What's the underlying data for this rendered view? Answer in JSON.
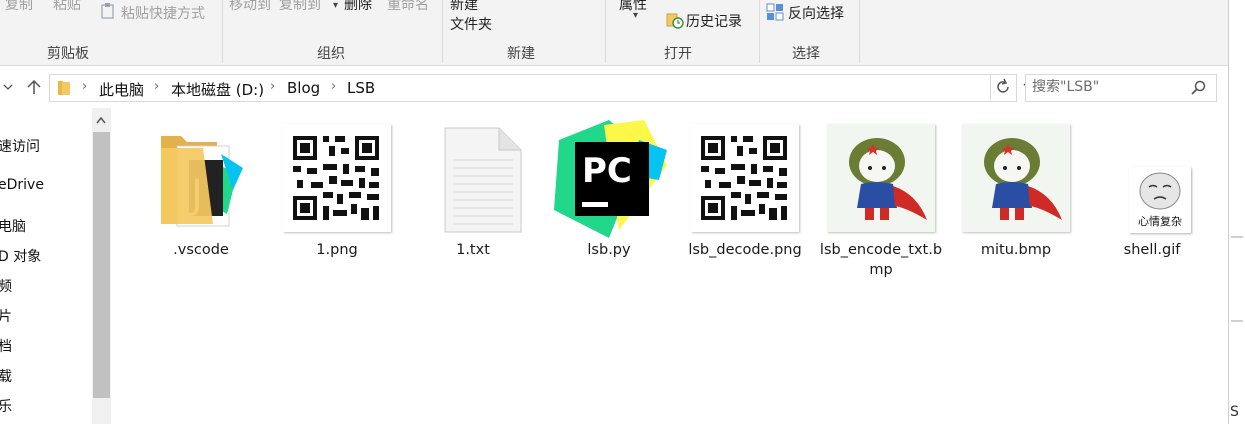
{
  "ribbon": {
    "clipboard": {
      "copy": "复制",
      "paste": "粘贴",
      "paste_shortcut": "粘贴快捷方式",
      "group": "剪贴板"
    },
    "organize": {
      "move_to": "移动到",
      "copy_to": "复制到",
      "delete": "删除",
      "rename": "重命名",
      "group": "组织"
    },
    "new": {
      "new_folder_line1": "新建",
      "new_folder_line2": "文件夹",
      "group": "新建"
    },
    "open": {
      "properties": "属性",
      "history": "历史记录",
      "group": "打开"
    },
    "select": {
      "invert": "反向选择",
      "group": "选择"
    }
  },
  "address": {
    "crumbs": [
      "此电脑",
      "本地磁盘 (D:)",
      "Blog",
      "LSB"
    ]
  },
  "search": {
    "placeholder": "搜索\"LSB\""
  },
  "sidebar": {
    "items": [
      "速访问",
      "eDrive",
      "电脑",
      "D 对象",
      "频",
      "片",
      "档",
      "载",
      "乐"
    ]
  },
  "files": [
    {
      "name": ".vscode",
      "icon": "folder-icon"
    },
    {
      "name": "1.png",
      "icon": "qr-code-thumbnail"
    },
    {
      "name": "1.txt",
      "icon": "text-file-icon"
    },
    {
      "name": "lsb.py",
      "icon": "pycharm-icon"
    },
    {
      "name": "lsb_decode.png",
      "icon": "qr-code-thumbnail"
    },
    {
      "name": "lsb_encode_txt.bmp",
      "icon": "mitu-thumbnail"
    },
    {
      "name": "mitu.bmp",
      "icon": "mitu-thumbnail"
    },
    {
      "name": "shell.gif",
      "icon": "meme-thumbnail"
    }
  ],
  "thumb_text": {
    "pycharm": "PC",
    "meme": "心情复杂"
  },
  "corner_text": "S",
  "colors": {
    "folder": "#f5c961",
    "pycharm_green": "#21d789",
    "pycharm_yellow": "#fcf84a",
    "pycharm_blue": "#07c3f2",
    "ribbon_bg": "#f3f3f3"
  }
}
